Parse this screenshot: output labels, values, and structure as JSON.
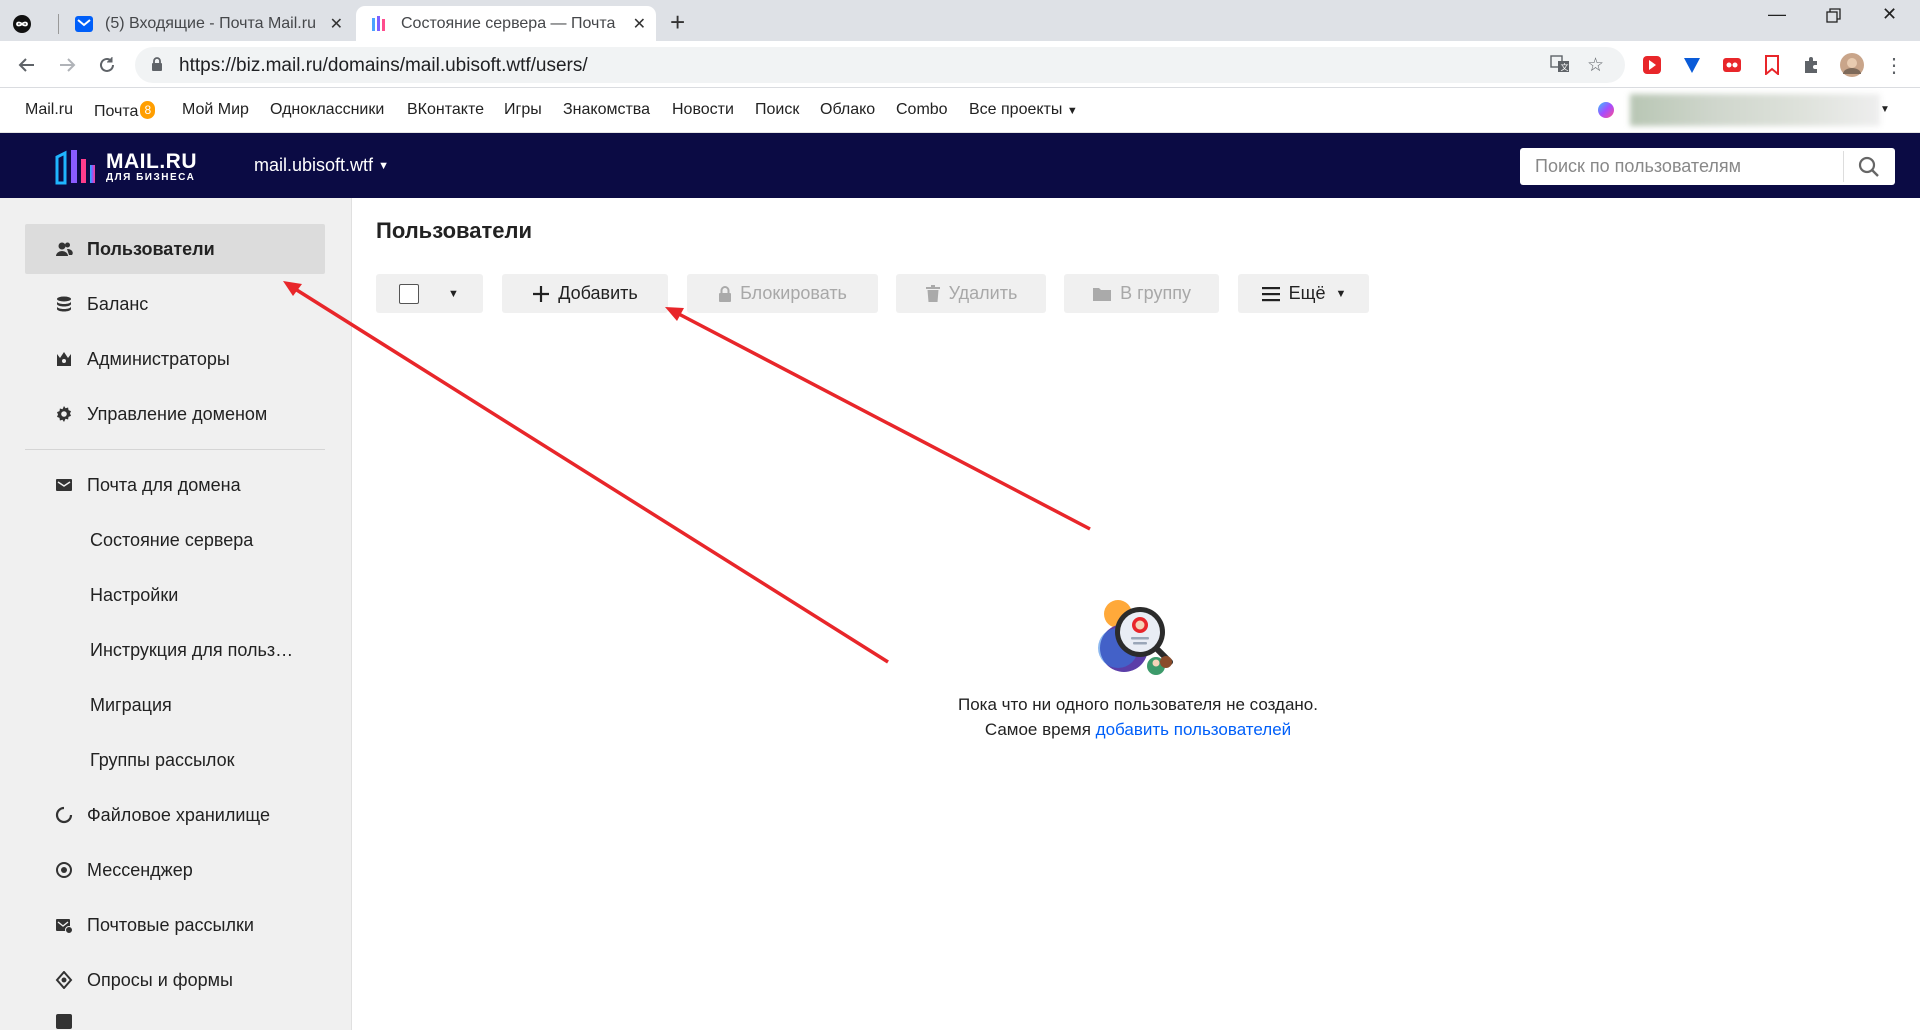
{
  "browser": {
    "tabs": [
      {
        "title": "(5) Входящие - Почта Mail.ru",
        "icon": "mail-icon"
      },
      {
        "title": "Состояние сервера — Почта для бизнеса",
        "icon": "mailru-biz-icon"
      }
    ],
    "new_tab": "+",
    "url": "https://biz.mail.ru/domains/mail.ubisoft.wtf/users/"
  },
  "portal": {
    "links": [
      "Mail.ru",
      "Почта",
      "Мой Мир",
      "Одноклассники",
      "ВКонтакте",
      "Игры",
      "Знакомства",
      "Новости",
      "Поиск",
      "Облако",
      "Combo",
      "Все проекты"
    ],
    "mail_badge": "8"
  },
  "header": {
    "logo_line1": "MAIL.RU",
    "logo_line2": "ДЛЯ БИЗНЕСА",
    "domain": "mail.ubisoft.wtf",
    "search_placeholder": "Поиск по пользователям"
  },
  "sidebar": {
    "items": [
      {
        "label": "Пользователи",
        "icon": "users-icon",
        "selected": true
      },
      {
        "label": "Баланс",
        "icon": "coins-icon"
      },
      {
        "label": "Администраторы",
        "icon": "crown-icon"
      },
      {
        "label": "Управление доменом",
        "icon": "gear-icon"
      },
      {
        "label": "Почта для домена",
        "icon": "envelope-icon"
      },
      {
        "label": "Состояние сервера"
      },
      {
        "label": "Настройки"
      },
      {
        "label": "Инструкция для польз…"
      },
      {
        "label": "Миграция"
      },
      {
        "label": "Группы рассылок"
      },
      {
        "label": "Файловое хранилище",
        "icon": "cloud-icon"
      },
      {
        "label": "Мессенджер",
        "icon": "chat-icon"
      },
      {
        "label": "Почтовые рассылки",
        "icon": "newsletter-icon"
      },
      {
        "label": "Опросы и формы",
        "icon": "survey-icon"
      }
    ]
  },
  "main": {
    "title": "Пользователи",
    "toolbar": {
      "add": "Добавить",
      "block": "Блокировать",
      "delete": "Удалить",
      "to_group": "В группу",
      "more": "Ещё"
    },
    "empty_line1": "Пока что ни одного пользователя не создано.",
    "empty_line2_prefix": "Самое время",
    "empty_link": "добавить пользователей"
  },
  "colors": {
    "header_bg": "#0b0b44",
    "link": "#005ff9",
    "arrow": "#e8262a",
    "badge": "#ff9e00"
  }
}
